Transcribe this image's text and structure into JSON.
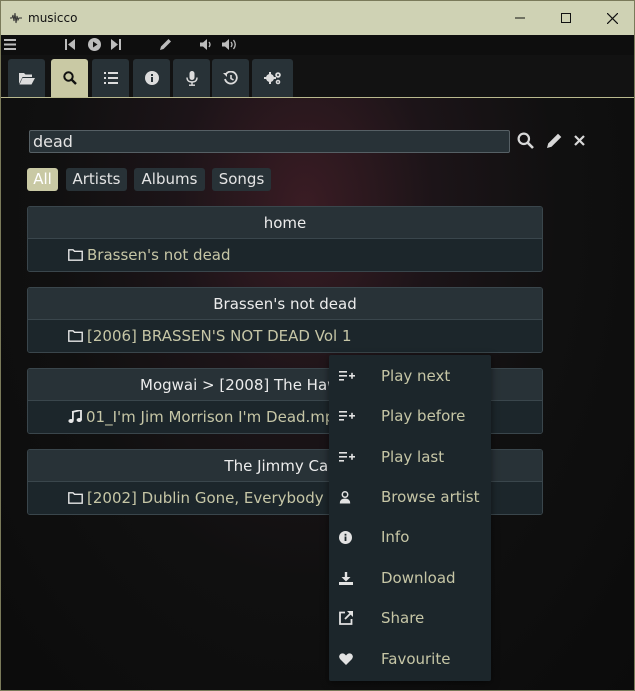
{
  "window": {
    "title": "musicco",
    "controls": [
      "minimize-icon",
      "maximize-icon",
      "close-icon"
    ]
  },
  "toolbar": {
    "icons": [
      "menu-icon",
      "previous-icon",
      "play-icon",
      "next-icon",
      "edit-icon",
      "volume-down-icon",
      "volume-up-icon"
    ]
  },
  "tabs": [
    {
      "icon": "folder-open-icon",
      "active": false
    },
    {
      "icon": "search-icon",
      "active": true
    },
    {
      "icon": "list-icon",
      "active": false
    },
    {
      "icon": "info-icon",
      "active": false
    },
    {
      "icon": "microphone-icon",
      "active": false
    },
    {
      "icon": "history-icon",
      "active": false
    },
    {
      "icon": "settings-icon",
      "active": false
    }
  ],
  "search": {
    "value": "dead",
    "placeholder": ""
  },
  "filters": [
    {
      "label": "All",
      "active": true
    },
    {
      "label": "Artists",
      "active": false
    },
    {
      "label": "Albums",
      "active": false
    },
    {
      "label": "Songs",
      "active": false
    }
  ],
  "results": [
    {
      "header": "home",
      "item": "Brassen's not dead",
      "item_icon": "folder-icon"
    },
    {
      "header": "Brassen's not dead",
      "item": "[2006] BRASSEN'S NOT DEAD Vol 1",
      "item_icon": "folder-icon"
    },
    {
      "header": "Mogwai > [2008] The Hawk Is Howling",
      "item": "01_I'm Jim Morrison I'm Dead.mp3",
      "item_icon": "music-note-icon"
    },
    {
      "header": "The Jimmy Cake",
      "item": "[2002] Dublin Gone, Everybody Dead",
      "item_icon": "folder-icon"
    }
  ],
  "context_menu": [
    {
      "label": "Play next",
      "icon": "playlist-add-icon"
    },
    {
      "label": "Play before",
      "icon": "playlist-add-icon"
    },
    {
      "label": "Play last",
      "icon": "playlist-add-icon"
    },
    {
      "label": "Browse artist",
      "icon": "user-icon"
    },
    {
      "label": "Info",
      "icon": "info-icon"
    },
    {
      "label": "Download",
      "icon": "download-icon"
    },
    {
      "label": "Share",
      "icon": "share-icon"
    },
    {
      "label": "Favourite",
      "icon": "heart-icon"
    }
  ],
  "colors": {
    "accent": "#c9c9a4",
    "panel": "#283237",
    "panel_dark": "#1c262b",
    "item_text": "#c6c6a6"
  }
}
